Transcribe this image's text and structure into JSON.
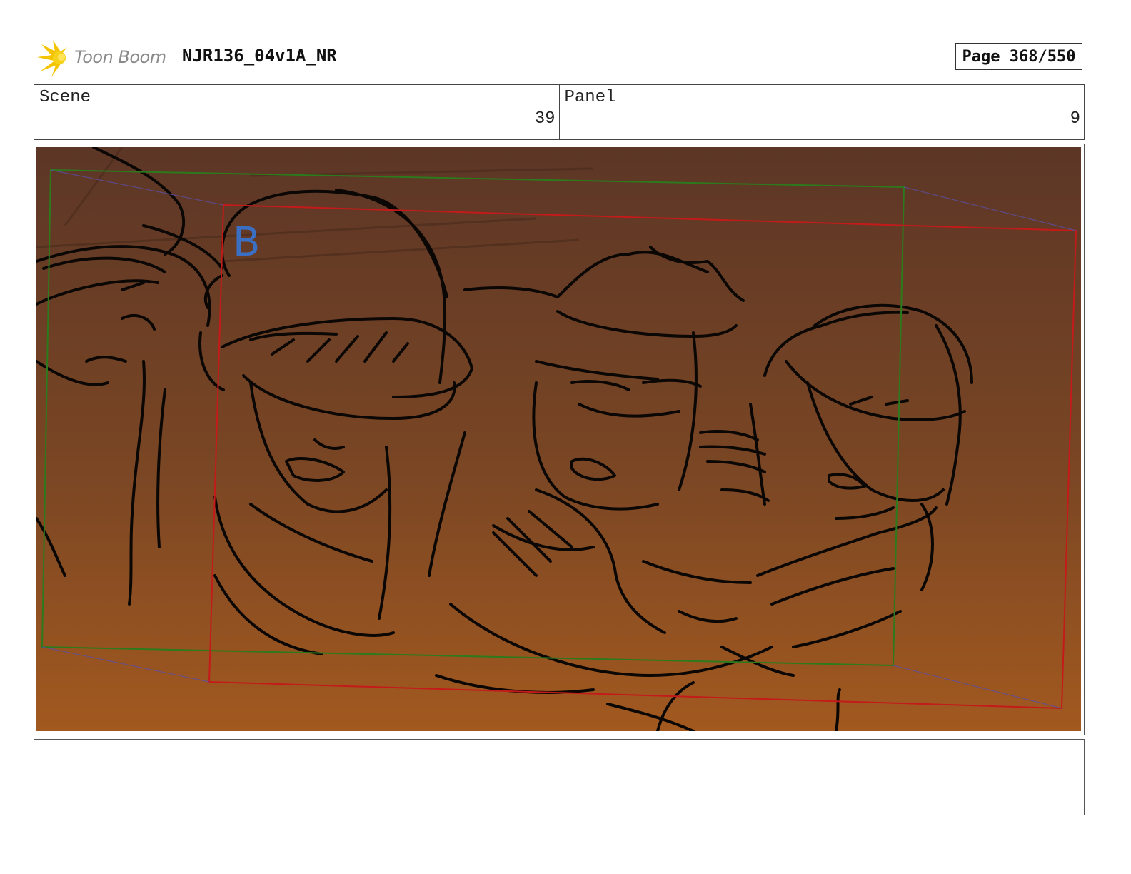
{
  "header": {
    "logo_text": "Toon Boom",
    "project_title": "NJR136_04v1A_NR",
    "page_label": "Page 368/550"
  },
  "info": {
    "scene_label": "Scene",
    "scene_value": "39",
    "panel_label": "Panel",
    "panel_value": "9"
  },
  "panel": {
    "layer_marker": "B",
    "colors": {
      "bg_top": "#5c3626",
      "bg_bottom": "#a2591f",
      "camera_frame_green": "#2c7a1c",
      "camera_frame_red": "#c41a1a",
      "marker_blue": "#3a6fc4",
      "sketch_ink": "#0b0705"
    }
  },
  "notes": {
    "text": ""
  }
}
